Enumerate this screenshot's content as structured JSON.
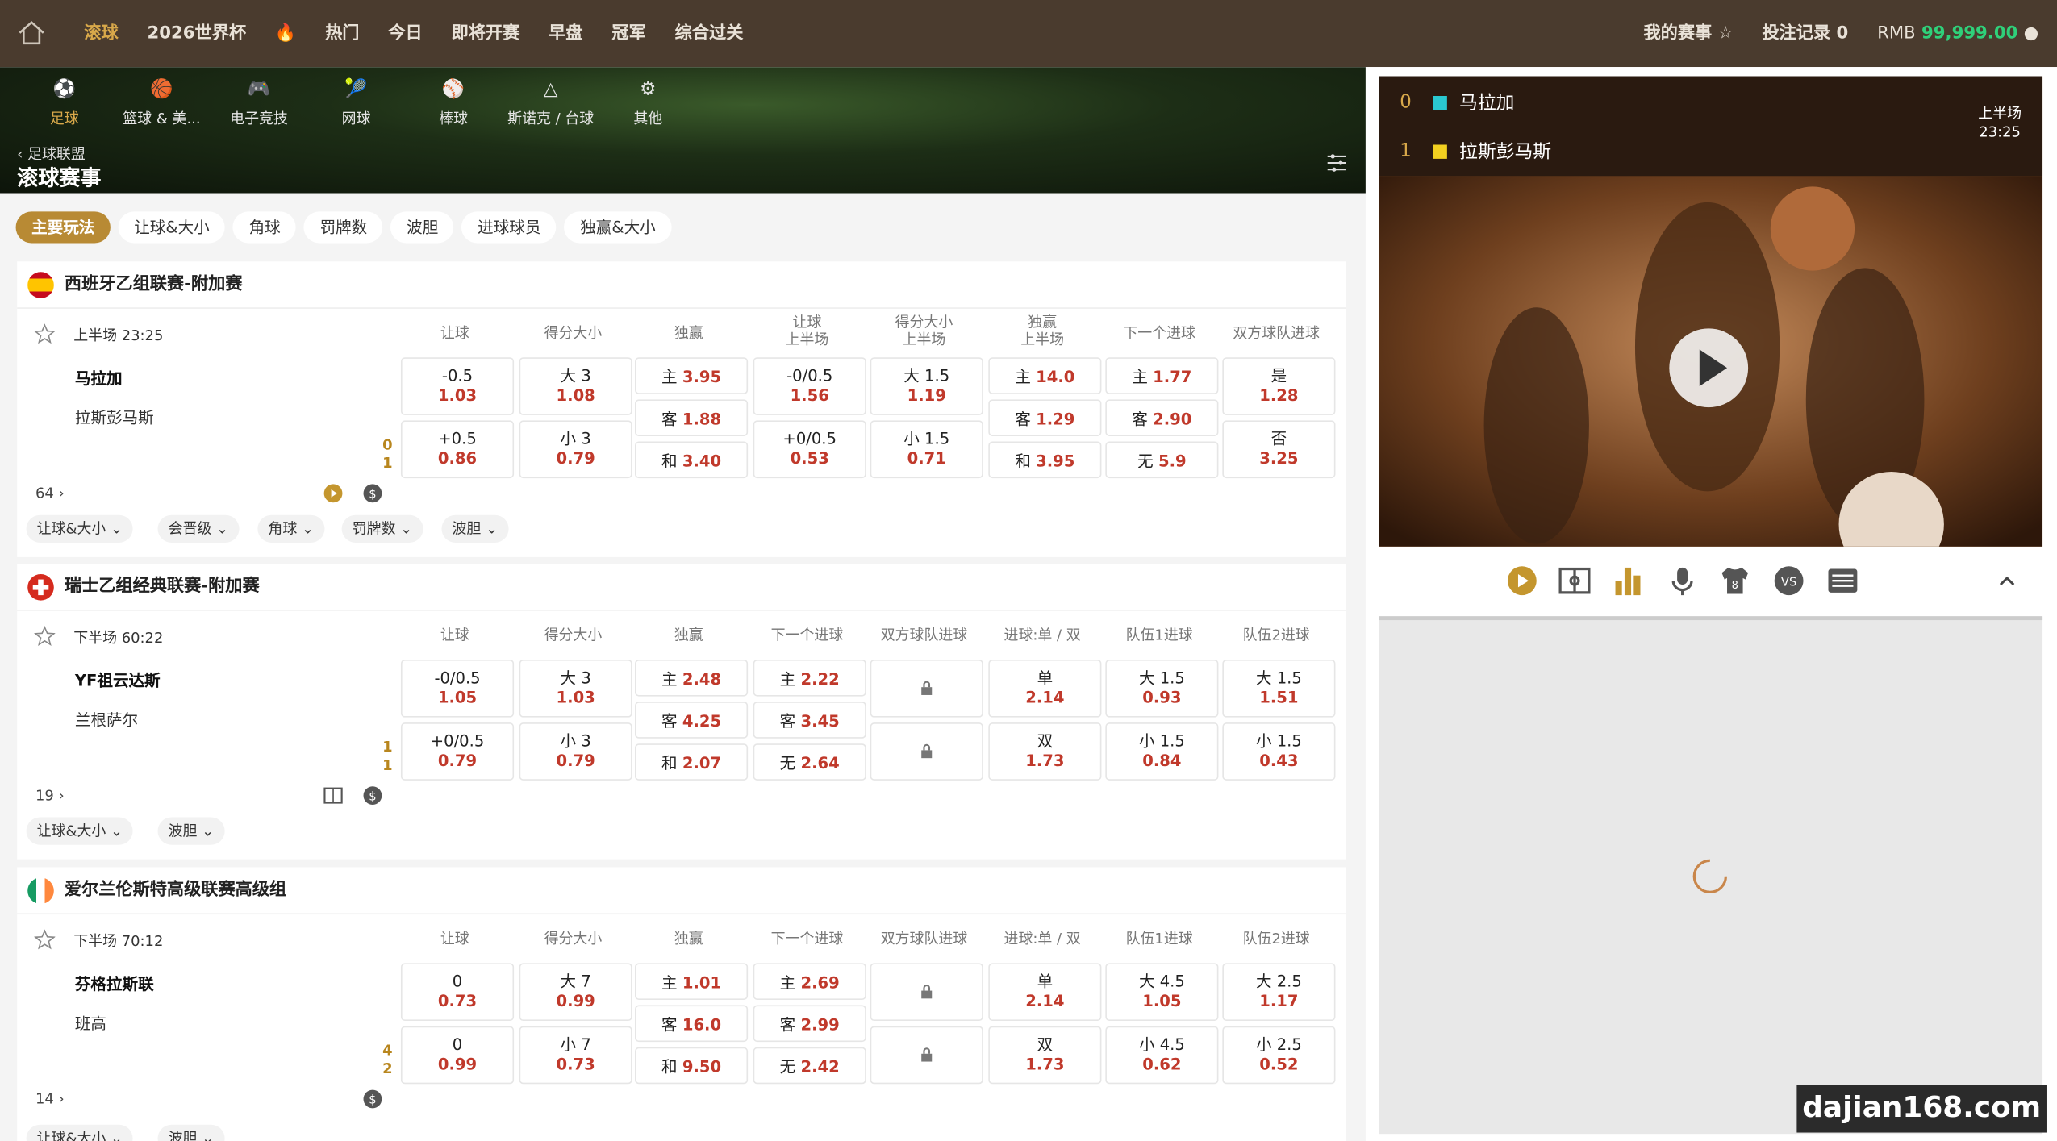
{
  "topnav": {
    "items": [
      "滚球",
      "2026世界杯",
      "热门",
      "今日",
      "即将开赛",
      "早盘",
      "冠军",
      "综合过关"
    ],
    "active": "滚球",
    "my_events": "我的赛事",
    "bet_record": "投注记录 0",
    "currency": "RMB",
    "balance": "99,999.00"
  },
  "sports": [
    "足球",
    "篮球 & 美...",
    "电子竞技",
    "网球",
    "棒球",
    "斯诺克 / 台球",
    "其他"
  ],
  "breadcrumb": "足球联盟",
  "page_title": "滚球赛事",
  "tabs": [
    "主要玩法",
    "让球&大小",
    "角球",
    "罚牌数",
    "波胆",
    "进球球员",
    "独赢&大小"
  ],
  "leagues": [
    {
      "name": "西班牙乙组联赛-附加赛",
      "time": "上半场  23:25",
      "home": "马拉加",
      "away": "拉斯彭马斯",
      "score_home": "0",
      "score_away": "1",
      "count": "64",
      "cols": [
        "让球",
        "得分大小",
        "独赢",
        "让球\n上半场",
        "得分大小\n上半场",
        "独赢\n上半场",
        "下一个进球",
        "双方球队进球"
      ],
      "r1": [
        [
          "-0.5",
          "1.03"
        ],
        [
          "大 3",
          "1.08"
        ],
        null,
        [
          "-0/0.5",
          "1.56"
        ],
        [
          "大 1.5",
          "1.19"
        ],
        null,
        null,
        [
          "是",
          "1.28"
        ]
      ],
      "r2": [
        [
          "+0.5",
          "0.86"
        ],
        [
          "小 3",
          "0.79"
        ],
        null,
        [
          "+0/0.5",
          "0.53"
        ],
        [
          "小 1.5",
          "0.71"
        ],
        null,
        null,
        [
          "否",
          "3.25"
        ]
      ],
      "three": {
        "c2": [
          [
            "主",
            "3.95"
          ],
          [
            "客",
            "1.88"
          ],
          [
            "和",
            "3.40"
          ]
        ],
        "c5": [
          [
            "主",
            "14.0"
          ],
          [
            "客",
            "1.29"
          ],
          [
            "和",
            "3.95"
          ]
        ],
        "c6": [
          [
            "主",
            "1.77"
          ],
          [
            "客",
            "2.90"
          ],
          [
            "无",
            "5.9"
          ]
        ]
      },
      "pills": [
        "让球&大小",
        "会晋级",
        "角球",
        "罚牌数",
        "波胆"
      ]
    },
    {
      "name": "瑞士乙组经典联赛-附加赛",
      "time": "下半场  60:22",
      "home": "YF祖云达斯",
      "away": "兰根萨尔",
      "score_home": "1",
      "score_away": "1",
      "count": "19",
      "cols": [
        "让球",
        "得分大小",
        "独赢",
        "下一个进球",
        "双方球队进球",
        "进球:单 / 双",
        "队伍1进球",
        "队伍2进球"
      ],
      "r1": [
        [
          "-0/0.5",
          "1.05"
        ],
        [
          "大 3",
          "1.03"
        ],
        null,
        null,
        "lock",
        [
          "单",
          "2.14"
        ],
        [
          "大 1.5",
          "0.93"
        ],
        [
          "大 1.5",
          "1.51"
        ]
      ],
      "r2": [
        [
          "+0/0.5",
          "0.79"
        ],
        [
          "小 3",
          "0.79"
        ],
        null,
        null,
        "lock",
        [
          "双",
          "1.73"
        ],
        [
          "小 1.5",
          "0.84"
        ],
        [
          "小 1.5",
          "0.43"
        ]
      ],
      "three": {
        "c2": [
          [
            "主",
            "2.48"
          ],
          [
            "客",
            "4.25"
          ],
          [
            "和",
            "2.07"
          ]
        ],
        "c3": [
          [
            "主",
            "2.22"
          ],
          [
            "客",
            "3.45"
          ],
          [
            "无",
            "2.64"
          ]
        ]
      },
      "pills": [
        "让球&大小",
        "波胆"
      ]
    },
    {
      "name": "爱尔兰伦斯特高级联赛高级组",
      "time": "下半场  70:12",
      "home": "芬格拉斯联",
      "away": "班高",
      "score_home": "4",
      "score_away": "2",
      "count": "14",
      "cols": [
        "让球",
        "得分大小",
        "独赢",
        "下一个进球",
        "双方球队进球",
        "进球:单 / 双",
        "队伍1进球",
        "队伍2进球"
      ],
      "r1": [
        [
          "0",
          "0.73"
        ],
        [
          "大 7",
          "0.99"
        ],
        null,
        null,
        "lock",
        [
          "单",
          "2.14"
        ],
        [
          "大 4.5",
          "1.05"
        ],
        [
          "大 2.5",
          "1.17"
        ]
      ],
      "r2": [
        [
          "0",
          "0.99"
        ],
        [
          "小 7",
          "0.73"
        ],
        null,
        null,
        "lock",
        [
          "双",
          "1.73"
        ],
        [
          "小 4.5",
          "0.62"
        ],
        [
          "小 2.5",
          "0.52"
        ]
      ],
      "three": {
        "c2": [
          [
            "主",
            "1.01"
          ],
          [
            "客",
            "16.0"
          ],
          [
            "和",
            "9.50"
          ]
        ],
        "c3": [
          [
            "主",
            "2.69"
          ],
          [
            "客",
            "2.99"
          ],
          [
            "无",
            "2.42"
          ]
        ]
      },
      "pills": [
        "让球&大小",
        "波胆"
      ]
    }
  ],
  "video": {
    "home_score": "0",
    "home": "马拉加",
    "away_score": "1",
    "away": "拉斯彭马斯",
    "period": "上半场",
    "clock": "23:25"
  },
  "watermark": "dajian168.com",
  "colors": {
    "brand": "#4a3b2e",
    "accent": "#b88a34",
    "odds": "#c0392b"
  }
}
